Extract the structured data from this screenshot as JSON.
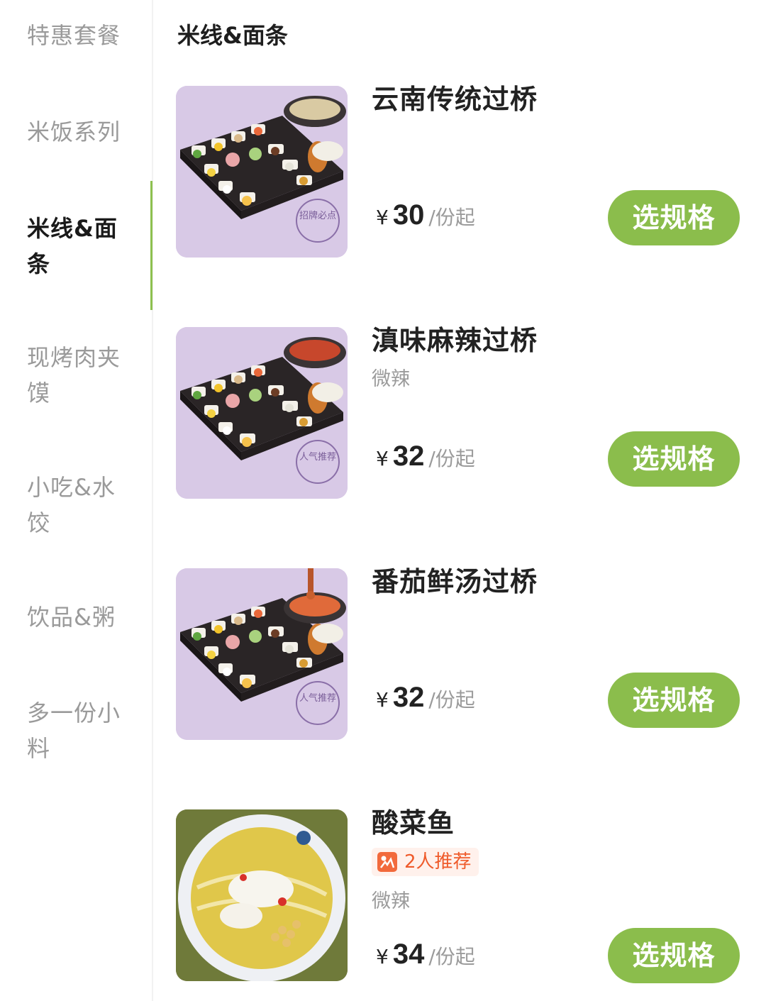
{
  "sidebar": {
    "categories": [
      {
        "label": "特惠套餐"
      },
      {
        "label": "米饭系列"
      },
      {
        "label": "米线&面\n条"
      },
      {
        "label": "现烤肉夹\n馍"
      },
      {
        "label": "小吃&水\n饺"
      },
      {
        "label": "饮品&粥"
      },
      {
        "label": "多一份小\n料"
      }
    ],
    "active_index": 2
  },
  "section": {
    "title": "米线&面条"
  },
  "theme": {
    "accent": "#8bbd4c",
    "recommend_color": "#ef5a2a"
  },
  "items": [
    {
      "name": "云南传统过桥",
      "tag": "",
      "recommend": "",
      "currency": "¥",
      "price": "30",
      "unit": "/份起",
      "button": "选规格",
      "image": "rice-noodle-set-clear-soup",
      "stamp": "招牌必点"
    },
    {
      "name": "滇味麻辣过桥",
      "tag": "微辣",
      "recommend": "",
      "currency": "¥",
      "price": "32",
      "unit": "/份起",
      "button": "选规格",
      "image": "rice-noodle-set-spicy-soup",
      "stamp": "人气推荐"
    },
    {
      "name": "番茄鲜汤过桥",
      "tag": "",
      "recommend": "",
      "currency": "¥",
      "price": "32",
      "unit": "/份起",
      "button": "选规格",
      "image": "rice-noodle-set-tomato-soup",
      "stamp": "人气推荐"
    },
    {
      "name": "酸菜鱼",
      "tag": "微辣",
      "recommend": "2人推荐",
      "currency": "¥",
      "price": "34",
      "unit": "/份起",
      "button": "选规格",
      "image": "pickled-fish-noodle-bowl"
    }
  ]
}
